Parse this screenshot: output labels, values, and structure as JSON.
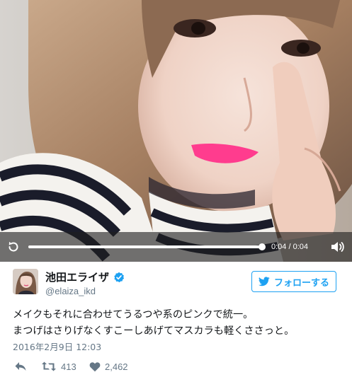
{
  "video": {
    "time_readout": "0:04 / 0:04",
    "progress_fraction": 1.0,
    "icons": [
      "replay-icon",
      "volume-icon"
    ]
  },
  "author": {
    "name": "池田エライザ",
    "handle": "@elaiza_ikd",
    "verified": true
  },
  "follow_button": {
    "label": "フォローする",
    "icon": "twitter-bird-icon",
    "color": "#1da1f2"
  },
  "tweet": {
    "lines": [
      "メイクもそれに合わせてうるつや系のピンクで統一。",
      "まつげはさりげなくすこーしあげてマスカラも軽くささっと。"
    ],
    "timestamp": "2016年2月9日 12:03"
  },
  "actions": {
    "reply_icon": "reply-icon",
    "retweet_icon": "retweet-icon",
    "retweet_count": "413",
    "like_icon": "heart-icon",
    "like_count": "2,462"
  }
}
